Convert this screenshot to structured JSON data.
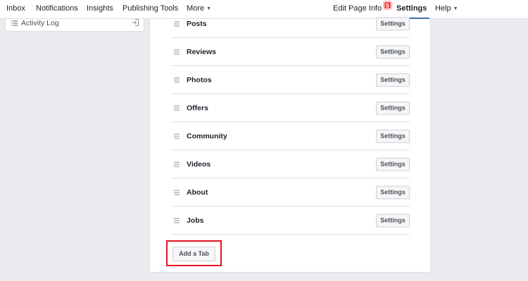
{
  "topnav": {
    "items": [
      {
        "label": "Inbox"
      },
      {
        "label": "Notifications"
      },
      {
        "label": "Insights"
      },
      {
        "label": "Publishing Tools"
      },
      {
        "label": "More",
        "icon": "caret-down-icon"
      }
    ],
    "edit_page_info": {
      "label": "Edit Page Info",
      "badge": "5"
    },
    "settings": {
      "label": "Settings",
      "active": true
    },
    "help": {
      "label": "Help",
      "icon": "caret-down-icon"
    }
  },
  "sidebar": {
    "activity_log": {
      "label": "Activity Log",
      "icon": "list-icon",
      "action_icon": "export-icon"
    }
  },
  "tabs": {
    "items": [
      {
        "label": "Posts",
        "button": "Settings"
      },
      {
        "label": "Reviews",
        "button": "Settings"
      },
      {
        "label": "Photos",
        "button": "Settings"
      },
      {
        "label": "Offers",
        "button": "Settings"
      },
      {
        "label": "Community",
        "button": "Settings"
      },
      {
        "label": "Videos",
        "button": "Settings"
      },
      {
        "label": "About",
        "button": "Settings"
      },
      {
        "label": "Jobs",
        "button": "Settings"
      }
    ],
    "add_tab_label": "Add a Tab"
  },
  "colors": {
    "background": "#e9ebee",
    "accent": "#4267b2",
    "badge": "#fa3e3e",
    "highlight": "#e5141e"
  }
}
